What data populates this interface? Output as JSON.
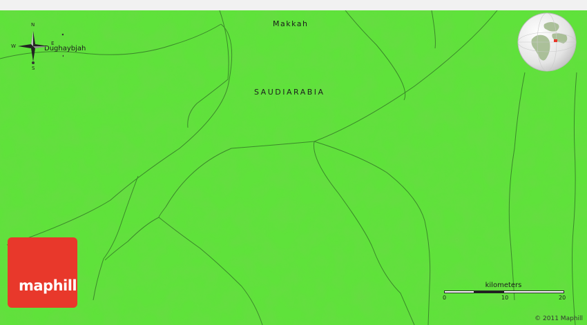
{
  "map": {
    "region_label": "SAUDIARABIA",
    "city_label": "Makkah",
    "place_label": "Dughaybjah",
    "colors": {
      "land": "#5fe23b",
      "land_dark": "#4fc92e",
      "river": "#2e6b24",
      "logo": "#e8382b"
    }
  },
  "compass": {
    "n": "N",
    "s": "S",
    "e": "E",
    "w": "W"
  },
  "logo": {
    "text": "maphill"
  },
  "scale": {
    "title": "kilometers",
    "ticks": [
      "0",
      "10",
      "20"
    ]
  },
  "copyright": "© 2011 Maphill"
}
